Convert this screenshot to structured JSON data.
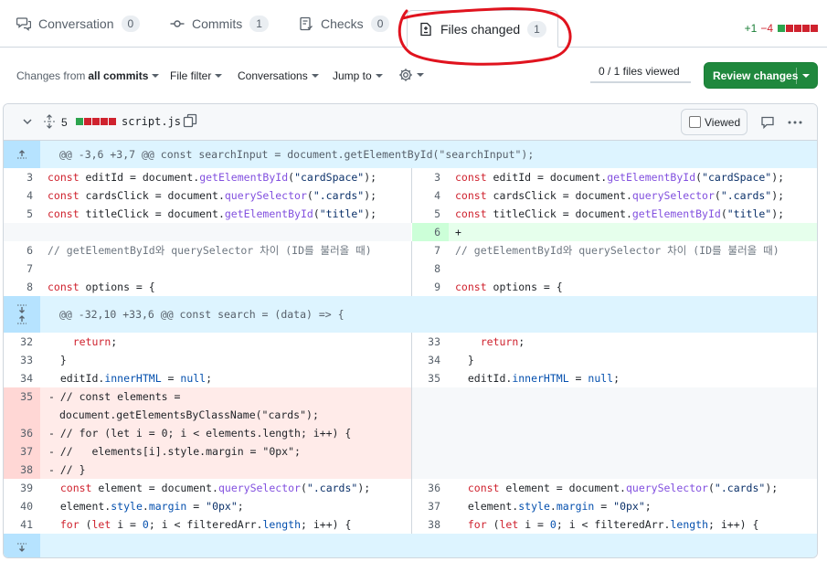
{
  "tabs": [
    {
      "label": "Conversation",
      "count": "0"
    },
    {
      "label": "Commits",
      "count": "1"
    },
    {
      "label": "Checks",
      "count": "0"
    },
    {
      "label": "Files changed",
      "count": "1"
    }
  ],
  "diffstat": {
    "additions": "+1",
    "deletions": "−4"
  },
  "toolbar": {
    "changes_from_prefix": "Changes from",
    "changes_from_value": "all commits",
    "file_filter": "File filter",
    "conversations": "Conversations",
    "jump_to": "Jump to",
    "files_viewed": "0 / 1 files viewed",
    "review_button": "Review changes"
  },
  "file": {
    "changed_lines": "5",
    "name": "script.js",
    "viewed_label": "Viewed",
    "hunks": [
      "@@ -3,6 +3,7 @@ const searchInput = document.getElementById(\"searchInput\");",
      "@@ -32,10 +33,6 @@ const search = (data) => {"
    ],
    "lines": [
      {
        "left_num": "3",
        "right_num": "3",
        "code": "const editId = document.getElementById(\"cardSpace\");"
      },
      {
        "left_num": "4",
        "right_num": "4",
        "code": "const cardsClick = document.querySelector(\".cards\");"
      },
      {
        "left_num": "5",
        "right_num": "5",
        "code": "const titleClick = document.getElementById(\"title\");"
      },
      {
        "left_num": "",
        "right_num": "6",
        "code": "+"
      },
      {
        "left_num": "6",
        "right_num": "7",
        "code": "// getElementById와 querySelector 차이 (ID를 불러올 때)"
      },
      {
        "left_num": "7",
        "right_num": "8",
        "code": ""
      },
      {
        "left_num": "8",
        "right_num": "9",
        "code": "const options = {"
      },
      {
        "left_num": "32",
        "right_num": "33",
        "code": "    return;"
      },
      {
        "left_num": "33",
        "right_num": "34",
        "code": "  }"
      },
      {
        "left_num": "34",
        "right_num": "35",
        "code": "  editId.innerHTML = null;"
      },
      {
        "left_num": "35",
        "right_num": "",
        "code": "  // const elements ="
      },
      {
        "left_num": "",
        "right_num": "",
        "code": "document.getElementsByClassName(\"cards\");"
      },
      {
        "left_num": "36",
        "right_num": "",
        "code": "  // for (let i = 0; i < elements.length; i++) {"
      },
      {
        "left_num": "37",
        "right_num": "",
        "code": "  //   elements[i].style.margin = \"0px\";"
      },
      {
        "left_num": "38",
        "right_num": "",
        "code": "  // }"
      },
      {
        "left_num": "39",
        "right_num": "36",
        "code": "  const element = document.querySelector(\".cards\");"
      },
      {
        "left_num": "40",
        "right_num": "37",
        "code": "  element.style.margin = \"0px\";"
      },
      {
        "left_num": "41",
        "right_num": "38",
        "code": "  for (let i = 0; i < filteredArr.length; i++) {"
      }
    ]
  },
  "colors": {
    "accent_green": "#1f883d",
    "deletion": "#cf222e",
    "hunk_bg": "#ddf4ff",
    "annotation_red": "#e0131e"
  }
}
